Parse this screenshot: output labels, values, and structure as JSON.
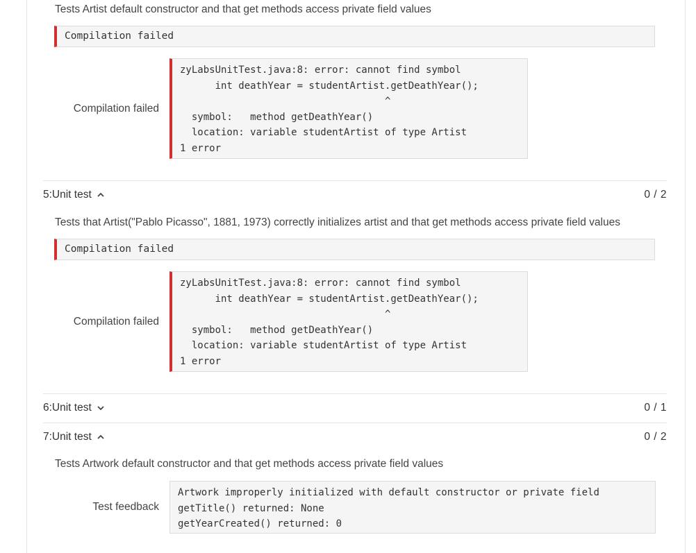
{
  "colors": {
    "error_accent": "#d03030",
    "box_bg": "#f5f5f5"
  },
  "test4": {
    "description": "Tests Artist default constructor and that get methods access private field values",
    "result_banner": "Compilation failed",
    "result_label": "Compilation failed",
    "output": "zyLabsUnitTest.java:8: error: cannot find symbol\n      int deathYear = studentArtist.getDeathYear();\n                                   ^\n  symbol:   method getDeathYear()\n  location: variable studentArtist of type Artist\n1 error"
  },
  "test5": {
    "title": "5:Unit test",
    "expanded_icon": "chevron-up-icon",
    "score": "0 / 2",
    "description": "Tests that Artist(\"Pablo Picasso\", 1881, 1973) correctly initializes artist and that get methods access private field values",
    "result_banner": "Compilation failed",
    "result_label": "Compilation failed",
    "output": "zyLabsUnitTest.java:8: error: cannot find symbol\n      int deathYear = studentArtist.getDeathYear();\n                                   ^\n  symbol:   method getDeathYear()\n  location: variable studentArtist of type Artist\n1 error"
  },
  "test6": {
    "title": "6:Unit test",
    "expanded_icon": "chevron-down-icon",
    "score": "0 / 1"
  },
  "test7": {
    "title": "7:Unit test",
    "expanded_icon": "chevron-up-icon",
    "score": "0 / 2",
    "description": "Tests Artwork default constructor and that get methods access private field values",
    "result_label": "Test feedback",
    "output": "Artwork improperly initialized with default constructor or private field\ngetTitle() returned: None\ngetYearCreated() returned: 0"
  }
}
